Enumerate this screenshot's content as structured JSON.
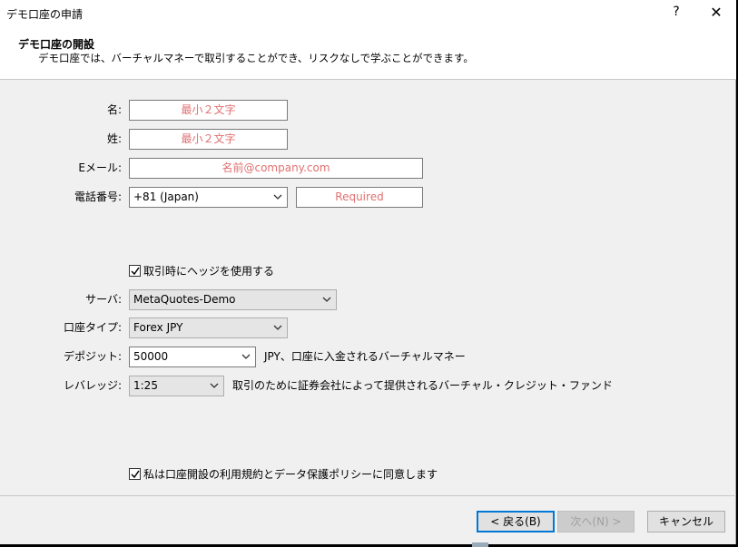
{
  "window": {
    "title": "デモ口座の申請",
    "help": "?",
    "close": "✕"
  },
  "header": {
    "title": "デモ口座の開設",
    "description": "デモ口座では、バーチャルマネーで取引することができ、リスクなしで学ぶことができます。"
  },
  "form": {
    "first_name": {
      "label": "名:",
      "placeholder": "最小２文字"
    },
    "last_name": {
      "label": "姓:",
      "placeholder": "最小２文字"
    },
    "email": {
      "label": "Eメール:",
      "placeholder": "名前@company.com"
    },
    "phone": {
      "label": "電話番号:",
      "country": "+81 (Japan)",
      "placeholder": "Required"
    },
    "hedge": {
      "label": "取引時にヘッジを使用する",
      "checked": true
    },
    "server": {
      "label": "サーバ:",
      "value": "MetaQuotes-Demo"
    },
    "account_type": {
      "label": "口座タイプ:",
      "value": "Forex JPY"
    },
    "deposit": {
      "label": "デポジット:",
      "value": "50000",
      "note": "JPY、口座に入金されるバーチャルマネー"
    },
    "leverage": {
      "label": "レバレッジ:",
      "value": "1:25",
      "note": "取引のために証券会社によって提供されるバーチャル・クレジット・ファンド"
    },
    "agree": {
      "label": "私は口座開設の利用規約とデータ保護ポリシーに同意します",
      "checked": true
    }
  },
  "buttons": {
    "back": "< 戻る(B)",
    "next": "次へ(N) >",
    "cancel": "キャンセル"
  },
  "colors": {
    "placeholder": "#e07070",
    "focus_border": "#0078d7"
  }
}
